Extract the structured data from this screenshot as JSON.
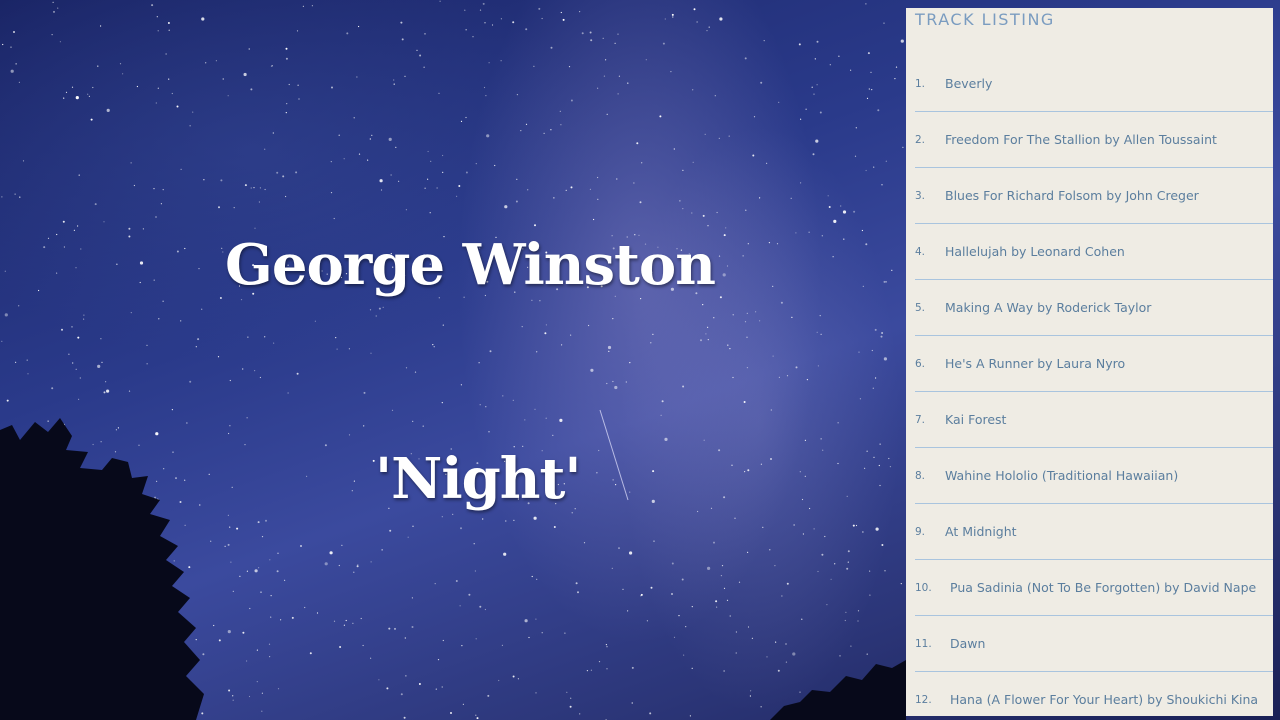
{
  "album": {
    "artist": "George Winston",
    "title": "'Night'"
  },
  "track_listing": {
    "heading": "TRACK LISTING",
    "tracks": [
      {
        "num": "1.",
        "title": "Beverly"
      },
      {
        "num": "2.",
        "title": "Freedom For The Stallion by Allen Toussaint"
      },
      {
        "num": "3.",
        "title": "Blues For Richard Folsom by John Creger"
      },
      {
        "num": "4.",
        "title": "Hallelujah by Leonard Cohen"
      },
      {
        "num": "5.",
        "title": "Making A Way by Roderick Taylor"
      },
      {
        "num": "6.",
        "title": "He's A Runner by Laura Nyro"
      },
      {
        "num": "7.",
        "title": "Kai Forest"
      },
      {
        "num": "8.",
        "title": "Wahine Hololio (Traditional Hawaiian)"
      },
      {
        "num": "9.",
        "title": "At Midnight"
      },
      {
        "num": "10.",
        "title": "Pua Sadinia (Not To Be Forgotten) by David Nape"
      },
      {
        "num": "11.",
        "title": "Dawn"
      },
      {
        "num": "12.",
        "title": "Hana (A Flower For Your Heart) by Shoukichi Kina"
      }
    ]
  },
  "colors": {
    "panel_background": "#efece4",
    "track_text": "#5b7e9e",
    "divider": "#a9c4de",
    "sky": "#2a3a8a"
  }
}
